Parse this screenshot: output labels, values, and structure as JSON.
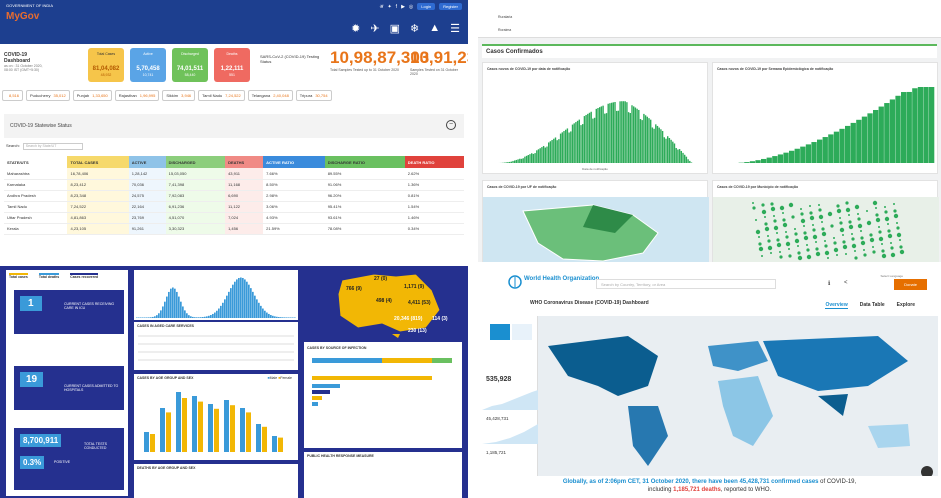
{
  "india": {
    "gov": "GOVERNMENT OF INDIA",
    "logo": "MyGov",
    "login": "Login",
    "register": "Register",
    "title": "COVID-19 Dashboard",
    "asof": "as on : 31 October 2020, 08:00 IST (GMT+5:30)",
    "boxes": [
      {
        "label": "Total Cases",
        "value": "81,04,082",
        "delta": "48,932",
        "bg": "#f6c54a"
      },
      {
        "label": "Active",
        "value": "5,70,458",
        "delta": "10,741",
        "bg": "#5aa4e6"
      },
      {
        "label": "Discharged",
        "value": "74,01,511",
        "delta": "58,440",
        "bg": "#6fc25a"
      },
      {
        "label": "Deaths",
        "value": "1,22,111",
        "delta": "551",
        "bg": "#ef6a61"
      }
    ],
    "sars": "SARS-CoV-2 (COVID-19) Testing Status",
    "tests_total": "10,98,87,303",
    "tests_total_sub": "Total Samples Tested up to 31 October 2020",
    "tests_day": "10,91,239",
    "tests_day_sub": "Samples Tested on 31 October 2020",
    "states_strip": [
      {
        "n": "",
        "v": "8,516"
      },
      {
        "n": "Puducherry",
        "v": "35,012"
      },
      {
        "n": "Punjab",
        "v": "1,33,650"
      },
      {
        "n": "Rajasthan",
        "v": "1,96,995"
      },
      {
        "n": "Sikkim",
        "v": "3,946"
      },
      {
        "n": "Tamil Nadu",
        "v": "7,24,522"
      },
      {
        "n": "Telangana",
        "v": "2,40,048"
      },
      {
        "n": "Tripura",
        "v": "30,754"
      }
    ],
    "panel_title": "COVID-19 Statewise Status",
    "search_label": "Search:",
    "search_placeholder": "Search by State/UT",
    "headers": [
      "STATE/UTS",
      "TOTAL CASES",
      "ACTIVE",
      "DISCHARGED",
      "DEATHS",
      "ACTIVE RATIO",
      "DISCHARGE RATIO",
      "DEATH RATIO"
    ],
    "rows": [
      [
        "Maharashtra",
        "16,78,406",
        "1,28,142",
        "15,03,050",
        "43,911",
        "7.66%",
        "89.55%",
        "2.62%"
      ],
      [
        "Karnataka",
        "8,23,412",
        "70,036",
        "7,41,398",
        "11,168",
        "8.50%",
        "91.06%",
        "1.36%"
      ],
      [
        "Andhra Pradesh",
        "8,23,348",
        "24,575",
        "7,92,083",
        "6,690",
        "2.98%",
        "96.20%",
        "0.81%"
      ],
      [
        "Tamil Nadu",
        "7,24,522",
        "22,164",
        "6,91,236",
        "11,122",
        "3.06%",
        "95.41%",
        "1.54%"
      ],
      [
        "Uttar Pradesh",
        "4,81,863",
        "23,769",
        "4,51,070",
        "7,024",
        "4.93%",
        "93.61%",
        "1.46%"
      ],
      [
        "Kerala",
        "4,23,105",
        "91,261",
        "3,30,323",
        "1,456",
        "21.59%",
        "78.08%",
        "0.34%"
      ]
    ]
  },
  "brazil": {
    "rows": [
      "Ruralaria",
      "Roraima"
    ],
    "section": "Casos Confirmados",
    "chart1_title": "Casos novos de COVID-19 por data de notificação",
    "chart1_xlabel": "Data de notificação",
    "chart2_title": "Casos novos de COVID-19 por Semana Epidemiológica de notificação",
    "map1_title": "Casos de COVID-19 por UF de notificação",
    "map2_title": "Casos de COVID-19 por Município de notificação"
  },
  "aus": {
    "legend": [
      "Total cases",
      "Total deaths",
      "Cases recovered"
    ],
    "kpis": [
      {
        "value": "1",
        "label": "CURRENT CASES RECEIVING CARE IN ICU"
      },
      {
        "value": "19",
        "label": "CURRENT CASES ADMITTED TO HOSPITALS"
      },
      {
        "value": "8,700,911",
        "label": "TOTAL TESTS CONDUCTED"
      },
      {
        "value": "0.3%",
        "label": "POSITIVE"
      }
    ],
    "aged_title": "CASES IN AGED CARE SERVICES",
    "age_title": "CASES BY AGE GROUP AND SEX",
    "deaths_title": "DEATHS BY AGE GROUP AND SEX",
    "source_title": "CASES BY SOURCE OF INFECTION",
    "phr_title": "PUBLIC HEALTH RESPONSE MEASURE",
    "sex": [
      "Male",
      "Female"
    ],
    "map_labels": [
      "766 (9)",
      "27 (0)",
      "1,171 (9)",
      "498 (4)",
      "4,411 (53)",
      "20,346 (819)",
      "114 (3)",
      "230 (13)"
    ]
  },
  "who": {
    "org": "World Health Organization",
    "search": "Search by Country, Territory, or Area",
    "donate": "Donate",
    "lang": "Select Language",
    "title": "WHO Coronavirus Disease (COVID-19) Dashboard",
    "tabs": [
      "Overview",
      "Data Table",
      "Explore"
    ],
    "n1": "535,928",
    "n2": "45,428,731",
    "n3": "1,185,721",
    "foot1": "Globally, as of 2:06pm CET, 31 October 2020, there have been ",
    "foot_cases": "45,428,731 confirmed cases",
    "foot2": " of COVID-19,",
    "foot3": "including ",
    "foot_deaths": "1,185,721 deaths",
    "foot4": ", reported to WHO."
  },
  "colors": {
    "india_header": "#1d3f8f",
    "aus_bg": "#25308f",
    "brazil_green": "#2dab59",
    "who_blue": "#1a8fd0"
  }
}
